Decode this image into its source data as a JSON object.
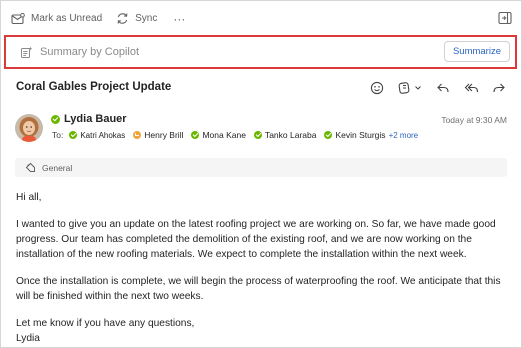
{
  "toolbar": {
    "mark_unread_label": "Mark as Unread",
    "sync_label": "Sync",
    "more_label": "···"
  },
  "copilot": {
    "title": "Summary by Copilot",
    "summarize_label": "Summarize"
  },
  "message": {
    "subject": "Coral Gables Project Update",
    "sender": "Lydia Bauer",
    "timestamp": "Today at 9:30 AM",
    "to_label": "To:",
    "recipients": [
      {
        "name": "Katri Ahokas",
        "status": "available"
      },
      {
        "name": "Henry Brill",
        "status": "away"
      },
      {
        "name": "Mona Kane",
        "status": "available"
      },
      {
        "name": "Tanko Laraba",
        "status": "available"
      },
      {
        "name": "Kevin Sturgis",
        "status": "available"
      }
    ],
    "more_recipients": "+2 more",
    "sensitivity_label": "General",
    "body": {
      "greeting": "Hi all,",
      "paragraph1": "I wanted to give you an update on the latest roofing project we are working on. So far, we have made good progress. Our team has completed the demolition of the existing roof, and we are now working on the installation of the new roofing materials. We expect to complete the installation within the next week.",
      "paragraph2": "Once the installation is complete, we will begin the process of waterproofing the roof. We anticipate that this will be finished within the next two weeks.",
      "closing": "Let me know if you have any questions,",
      "signature": "Lydia"
    }
  },
  "icons": {
    "mark_unread": "envelope-icon",
    "sync": "sync-icon",
    "collapse_pane": "collapse-pane-icon",
    "copilot": "copilot-summary-icon",
    "emoji": "emoji-icon",
    "loop": "loop-icon",
    "reply": "reply-icon",
    "reply_all": "reply-all-icon",
    "forward": "forward-icon",
    "tag": "tag-icon"
  },
  "colors": {
    "accent": "#2b64c2",
    "highlight_outline": "#d93a3a",
    "presence_available": "#6bb700",
    "presence_away": "#f1a33c"
  }
}
